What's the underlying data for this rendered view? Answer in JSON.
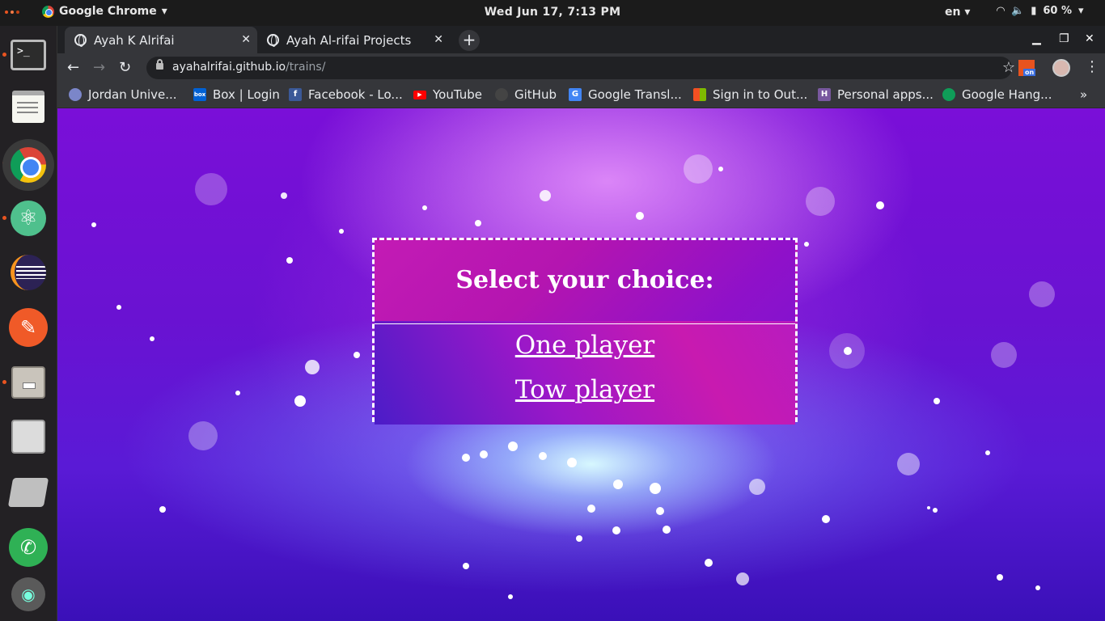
{
  "system_bar": {
    "app_name": "Google Chrome",
    "clock": "Wed Jun 17,  7:13 PM",
    "language": "en",
    "battery": "60 %"
  },
  "browser": {
    "tabs": [
      {
        "title": "Ayah K Alrifai",
        "active": true
      },
      {
        "title": "Ayah Al-rifai Projects",
        "active": false
      }
    ],
    "url_host": "ayahalrifai.github.io",
    "url_path": "/trains/",
    "extension_badge": "on",
    "bookmarks": [
      {
        "label": "Jordan Unive...",
        "icon": "university-icon",
        "color": "#7b86c9"
      },
      {
        "label": "Box | Login",
        "icon": "box-icon",
        "color": "#0061d5"
      },
      {
        "label": "Facebook - Lo...",
        "icon": "facebook-icon",
        "color": "#3b5998"
      },
      {
        "label": "YouTube",
        "icon": "youtube-icon",
        "color": "#ff0000"
      },
      {
        "label": "GitHub",
        "icon": "github-icon",
        "color": "#444444"
      },
      {
        "label": "Google Transl...",
        "icon": "translate-icon",
        "color": "#4285f4"
      },
      {
        "label": "Sign in to Out...",
        "icon": "microsoft-icon",
        "color": "#f25022"
      },
      {
        "label": "Personal apps...",
        "icon": "heroku-icon",
        "color": "#79589f"
      },
      {
        "label": "Google Hang...",
        "icon": "hangouts-icon",
        "color": "#0f9d58"
      }
    ]
  },
  "page": {
    "title": "Select your choice:",
    "options": [
      "One player",
      "Tow player"
    ]
  },
  "colors": {
    "accent": "#e95420",
    "box_border": "#ffffff"
  }
}
